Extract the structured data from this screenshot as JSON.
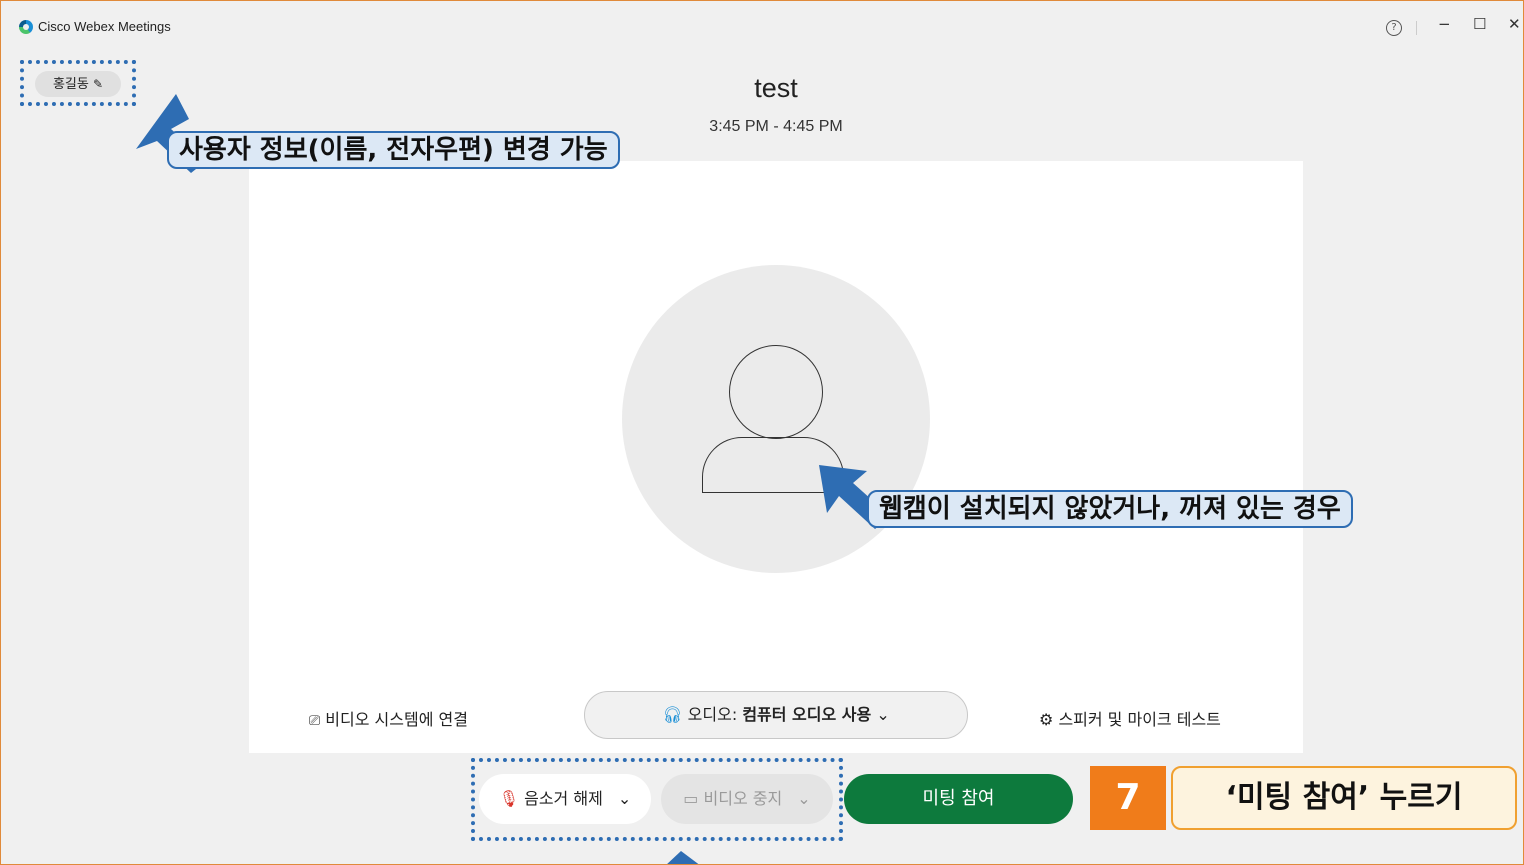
{
  "window": {
    "title": "Cisco Webex Meetings",
    "help_glyph": "?",
    "min_glyph": "−",
    "max_glyph": "☐",
    "close_glyph": "✕"
  },
  "user": {
    "name": "홍길동",
    "edit_icon": "✎"
  },
  "meeting": {
    "title": "test",
    "time": "3:45 PM - 4:45 PM"
  },
  "controls": {
    "video_system": "비디오 시스템에 연결",
    "audio_prefix": "오디오:",
    "audio_value": "컴퓨터 오디오 사용",
    "speaker_test": "스피커 및 마이크 테스트",
    "unmute": "음소거 해제",
    "stop_video": "비디오 중지",
    "join": "미팅 참여",
    "chevron": "⌄"
  },
  "annotations": {
    "user_info": "사용자 정보(이름, 전자우편) 변경 가능",
    "webcam": "웹캠이 설치되지 않았거나, 꺼져 있는 경우",
    "step_number": "7",
    "step_text": "‘미팅 참여’ 누르기"
  },
  "colors": {
    "accent_blue": "#2e6db3",
    "join_green": "#0d7a3d",
    "step_orange": "#f07c1a",
    "callout_bg": "#dce8f5"
  }
}
